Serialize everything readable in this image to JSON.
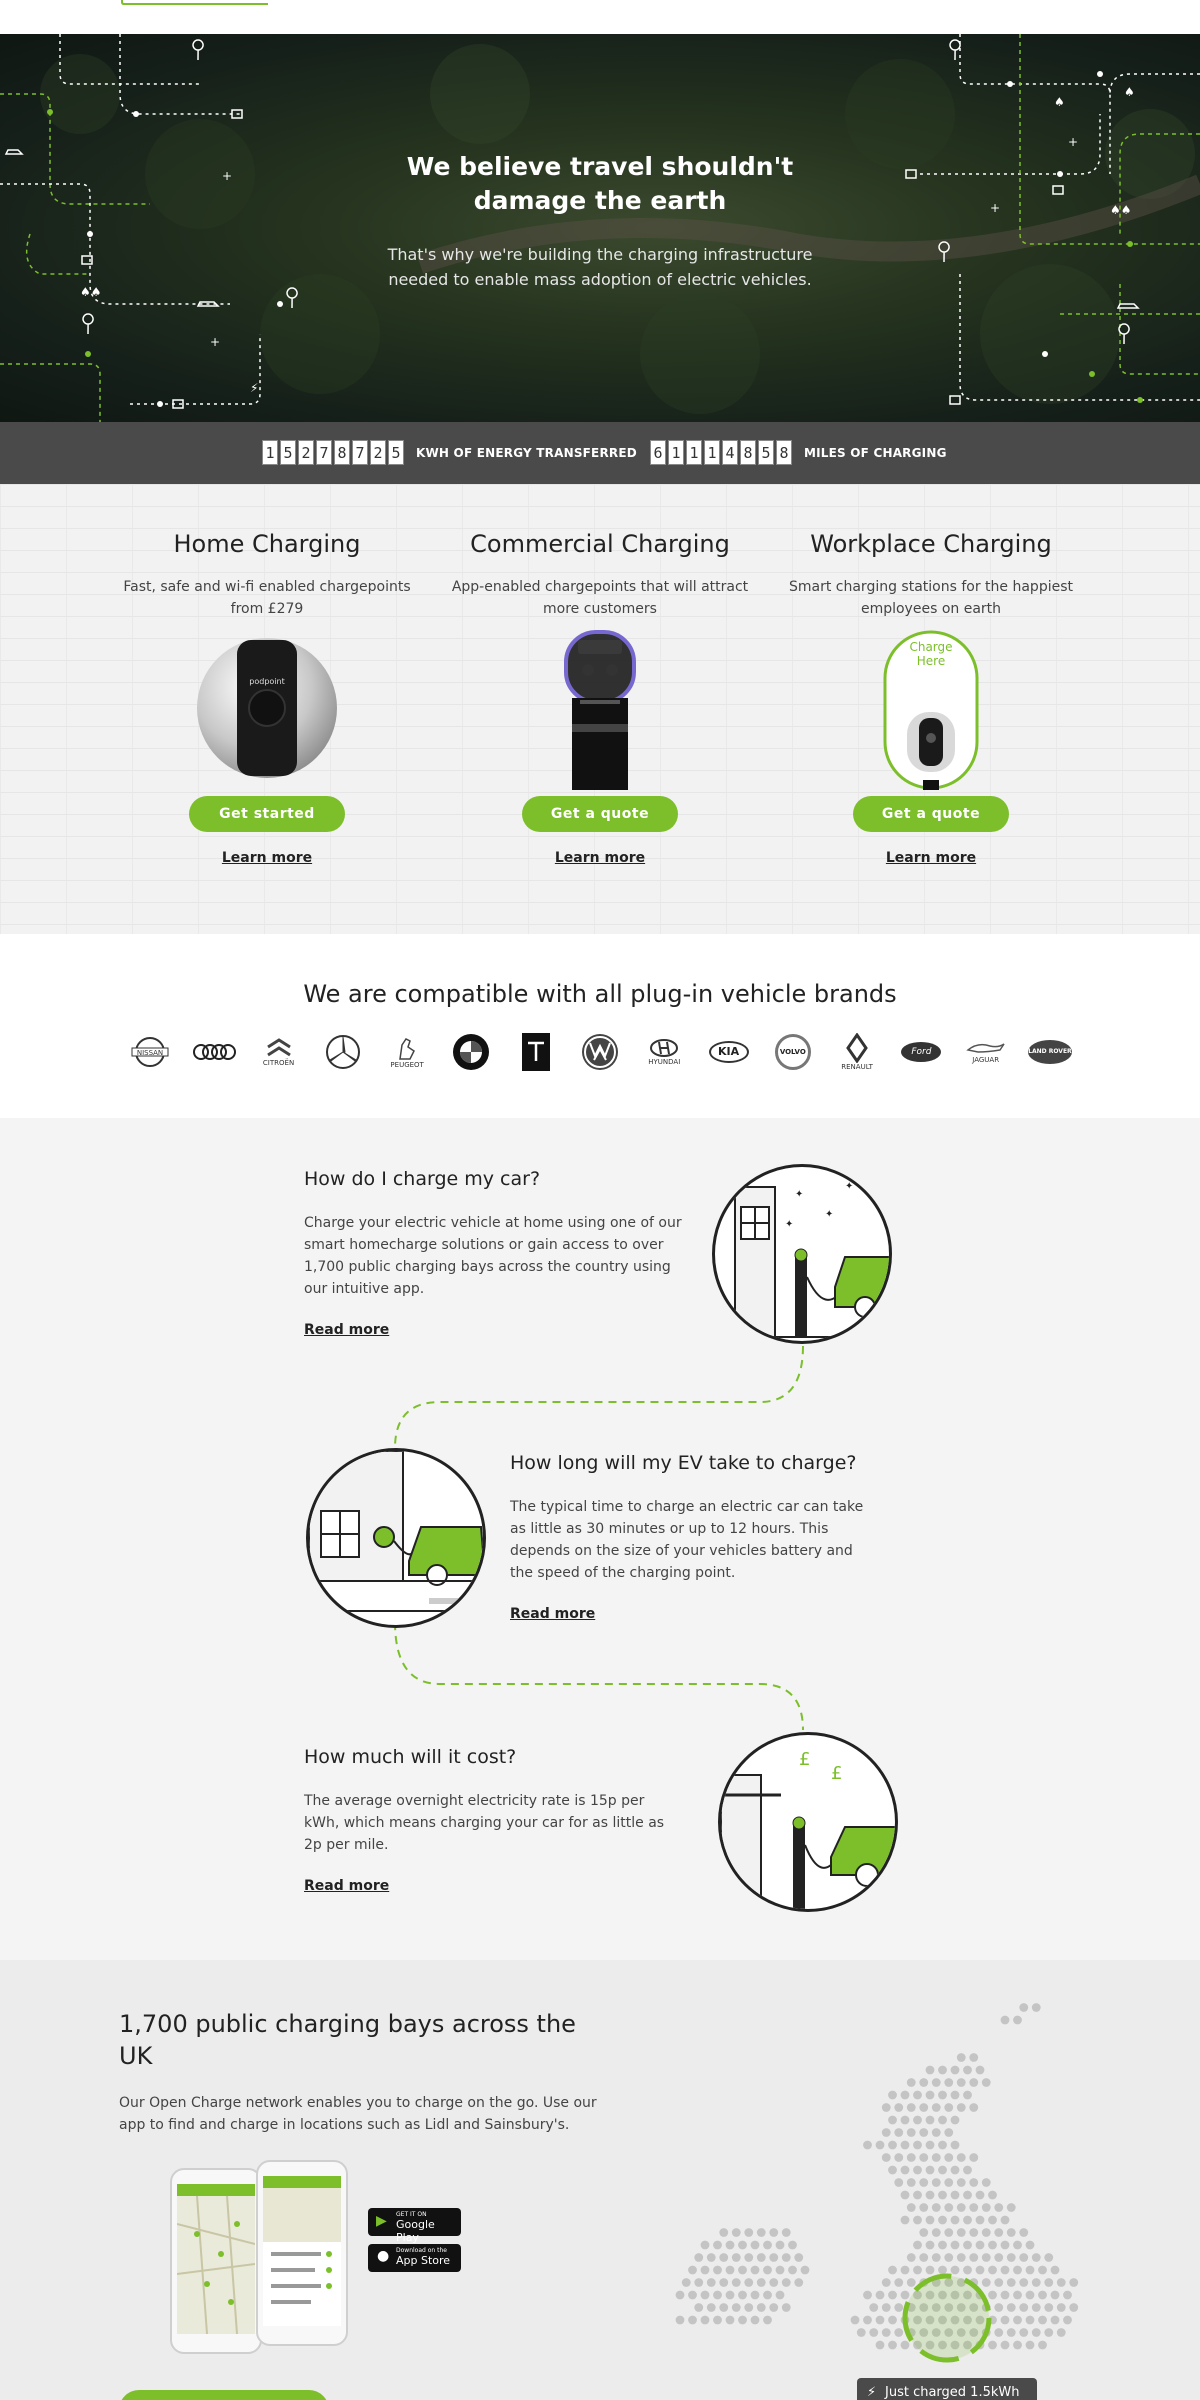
{
  "hero": {
    "title": "We believe travel shouldn't damage the earth",
    "subtitle": "That's why we're building the charging infrastructure needed to enable mass adoption of electric vehicles."
  },
  "counters": {
    "energy": {
      "digits": [
        "1",
        "5",
        "2",
        "7",
        "8",
        "7",
        "2",
        "5"
      ],
      "label": "KWH OF ENERGY TRANSFERRED"
    },
    "miles": {
      "digits": [
        "6",
        "1",
        "1",
        "1",
        "4",
        "8",
        "5",
        "8"
      ],
      "label": "MILES OF CHARGING"
    }
  },
  "products": [
    {
      "title": "Home Charging",
      "desc": "Fast, safe and wi-fi enabled chargepoints from £279",
      "button": "Get started",
      "link": "Learn more"
    },
    {
      "title": "Commercial Charging",
      "desc": "App-enabled chargepoints that will attract more customers",
      "button": "Get a quote",
      "link": "Learn more"
    },
    {
      "title": "Workplace Charging",
      "desc": "Smart charging stations for the happiest employees on earth",
      "button": "Get a quote",
      "link": "Learn more",
      "sign_text": "Charge Here"
    }
  ],
  "brands": {
    "title": "We are compatible with all plug-in vehicle brands",
    "items": [
      {
        "name": "nissan-logo",
        "caption": "NISSAN"
      },
      {
        "name": "audi-logo",
        "caption": ""
      },
      {
        "name": "citroen-logo",
        "caption": "CITROËN"
      },
      {
        "name": "mercedes-logo",
        "caption": ""
      },
      {
        "name": "peugeot-logo",
        "caption": "PEUGEOT"
      },
      {
        "name": "bmw-logo",
        "caption": ""
      },
      {
        "name": "tesla-logo",
        "caption": "TESLA"
      },
      {
        "name": "volkswagen-logo",
        "caption": ""
      },
      {
        "name": "hyundai-logo",
        "caption": "HYUNDAI"
      },
      {
        "name": "kia-logo",
        "caption": "KIA"
      },
      {
        "name": "volvo-logo",
        "caption": "VOLVO"
      },
      {
        "name": "renault-logo",
        "caption": "RENAULT"
      },
      {
        "name": "ford-logo",
        "caption": "Ford"
      },
      {
        "name": "jaguar-logo",
        "caption": "JAGUAR"
      },
      {
        "name": "landrover-logo",
        "caption": "LAND ROVER"
      }
    ]
  },
  "faq": [
    {
      "title": "How do I charge my car?",
      "body": "Charge your electric vehicle at home using one of our smart homecharge solutions or gain access to over 1,700 public charging bays across the country using our intuitive app.",
      "link": "Read more"
    },
    {
      "title": "How long will my EV take to charge?",
      "body": "The typical time to charge an electric car can take as little as 30 minutes or up to 12 hours. This depends on the size of your vehicles battery and the speed of the charging point.",
      "link": "Read more"
    },
    {
      "title": "How much will it cost?",
      "body": "The average overnight electricity rate is 15p per kWh, which means charging your car for as little as 2p per mile.",
      "link": "Read more"
    }
  ],
  "network": {
    "title": "1,700 public charging bays across the UK",
    "body": "Our Open Charge network enables you to charge on the go. Use our app to find and charge in locations such as Lidl and Sainsbury's.",
    "google_play_small": "GET IT ON",
    "google_play": "Google Play",
    "app_store_small": "Download on the",
    "app_store": "App Store",
    "toast": "Just charged 1.5kWh"
  },
  "colors": {
    "accent": "#7cbf2b",
    "dark_bar": "#4a4a4a"
  }
}
